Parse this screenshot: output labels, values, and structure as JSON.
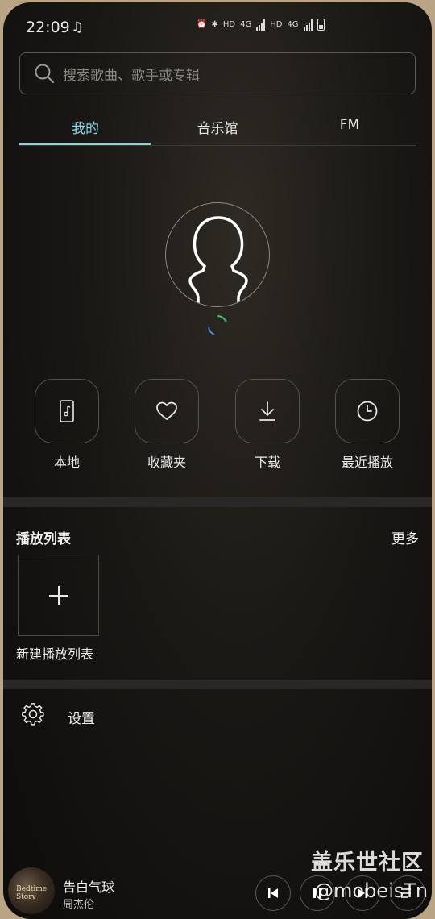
{
  "status": {
    "time": "22:09",
    "hd1": "HD",
    "net1": "4G",
    "hd2": "HD",
    "net2": "4G"
  },
  "search": {
    "placeholder": "搜索歌曲、歌手或专辑"
  },
  "tabs": [
    {
      "label": "我的",
      "active": true
    },
    {
      "label": "音乐馆",
      "active": false
    },
    {
      "label": "FM",
      "active": false
    }
  ],
  "quick_actions": [
    {
      "label": "本地",
      "icon": "phone-music-icon"
    },
    {
      "label": "收藏夹",
      "icon": "heart-icon"
    },
    {
      "label": "下载",
      "icon": "download-icon"
    },
    {
      "label": "最近播放",
      "icon": "clock-icon"
    }
  ],
  "playlists": {
    "title": "播放列表",
    "more": "更多",
    "new_label": "新建播放列表"
  },
  "settings": {
    "label": "设置"
  },
  "watermark": {
    "line1": "盖乐世社区",
    "line2": "@mobeisTn"
  },
  "player": {
    "song": "告白气球",
    "artist": "周杰伦",
    "album_art_text": "Bedtime Story"
  },
  "colors": {
    "accent": "#8fd3e0",
    "background": "#14120f"
  }
}
